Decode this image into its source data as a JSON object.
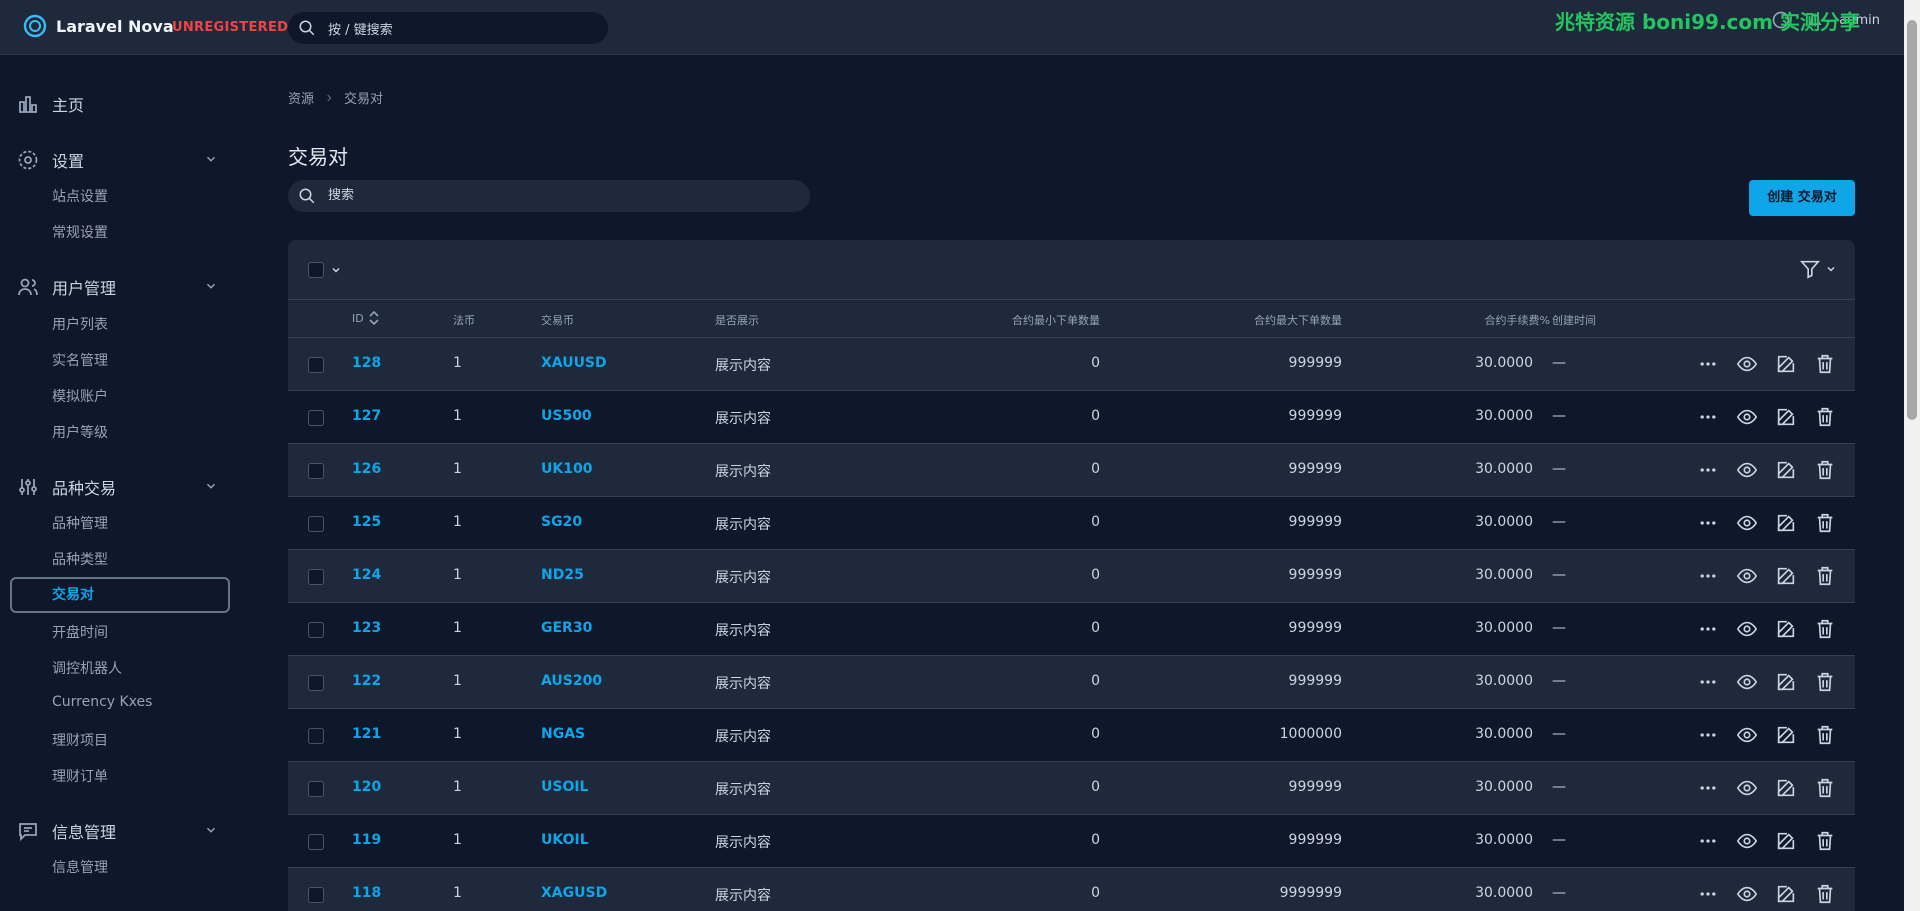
{
  "header": {
    "brand": "Laravel Nova",
    "license": "UNREGISTERED",
    "search_placeholder": "按 / 键搜索",
    "watermark": "兆特资源 boni99.com 实测分享",
    "user": "admin"
  },
  "sidebar": {
    "home": "主页",
    "settings": {
      "label": "设置",
      "items": [
        "站点设置",
        "常规设置"
      ]
    },
    "users": {
      "label": "用户管理",
      "items": [
        "用户列表",
        "实名管理",
        "模拟账户",
        "用户等级"
      ]
    },
    "trading": {
      "label": "品种交易",
      "items": [
        "品种管理",
        "品种类型",
        "交易对",
        "开盘时间",
        "调控机器人",
        "Currency Kxes",
        "理财项目",
        "理财订单"
      ],
      "active": "交易对"
    },
    "info": {
      "label": "信息管理",
      "items": [
        "信息管理"
      ]
    }
  },
  "breadcrumb": [
    "资源",
    "交易对"
  ],
  "page_title": "交易对",
  "resource_search_placeholder": "搜索",
  "create_button": "创建 交易对",
  "table": {
    "columns": [
      "ID",
      "法币",
      "交易币",
      "是否展示",
      "合约最小下单数量",
      "合约最大下单数量",
      "合约手续费%",
      "创建时间"
    ],
    "rows": [
      {
        "id": "128",
        "fiat": "1",
        "coin": "XAUUSD",
        "show": "展示内容",
        "min": "0",
        "max": "999999",
        "fee": "30.0000",
        "created": "—"
      },
      {
        "id": "127",
        "fiat": "1",
        "coin": "US500",
        "show": "展示内容",
        "min": "0",
        "max": "999999",
        "fee": "30.0000",
        "created": "—"
      },
      {
        "id": "126",
        "fiat": "1",
        "coin": "UK100",
        "show": "展示内容",
        "min": "0",
        "max": "999999",
        "fee": "30.0000",
        "created": "—"
      },
      {
        "id": "125",
        "fiat": "1",
        "coin": "SG20",
        "show": "展示内容",
        "min": "0",
        "max": "999999",
        "fee": "30.0000",
        "created": "—"
      },
      {
        "id": "124",
        "fiat": "1",
        "coin": "ND25",
        "show": "展示内容",
        "min": "0",
        "max": "999999",
        "fee": "30.0000",
        "created": "—"
      },
      {
        "id": "123",
        "fiat": "1",
        "coin": "GER30",
        "show": "展示内容",
        "min": "0",
        "max": "999999",
        "fee": "30.0000",
        "created": "—"
      },
      {
        "id": "122",
        "fiat": "1",
        "coin": "AUS200",
        "show": "展示内容",
        "min": "0",
        "max": "999999",
        "fee": "30.0000",
        "created": "—"
      },
      {
        "id": "121",
        "fiat": "1",
        "coin": "NGAS",
        "show": "展示内容",
        "min": "0",
        "max": "1000000",
        "fee": "30.0000",
        "created": "—"
      },
      {
        "id": "120",
        "fiat": "1",
        "coin": "USOIL",
        "show": "展示内容",
        "min": "0",
        "max": "999999",
        "fee": "30.0000",
        "created": "—"
      },
      {
        "id": "119",
        "fiat": "1",
        "coin": "UKOIL",
        "show": "展示内容",
        "min": "0",
        "max": "999999",
        "fee": "30.0000",
        "created": "—"
      },
      {
        "id": "118",
        "fiat": "1",
        "coin": "XAGUSD",
        "show": "展示内容",
        "min": "0",
        "max": "9999999",
        "fee": "30.0000",
        "created": "—"
      }
    ]
  },
  "colors": {
    "accent": "#0ea5e9",
    "danger": "#ef4444",
    "bg": "#0f172a",
    "panel": "#1e293b"
  }
}
